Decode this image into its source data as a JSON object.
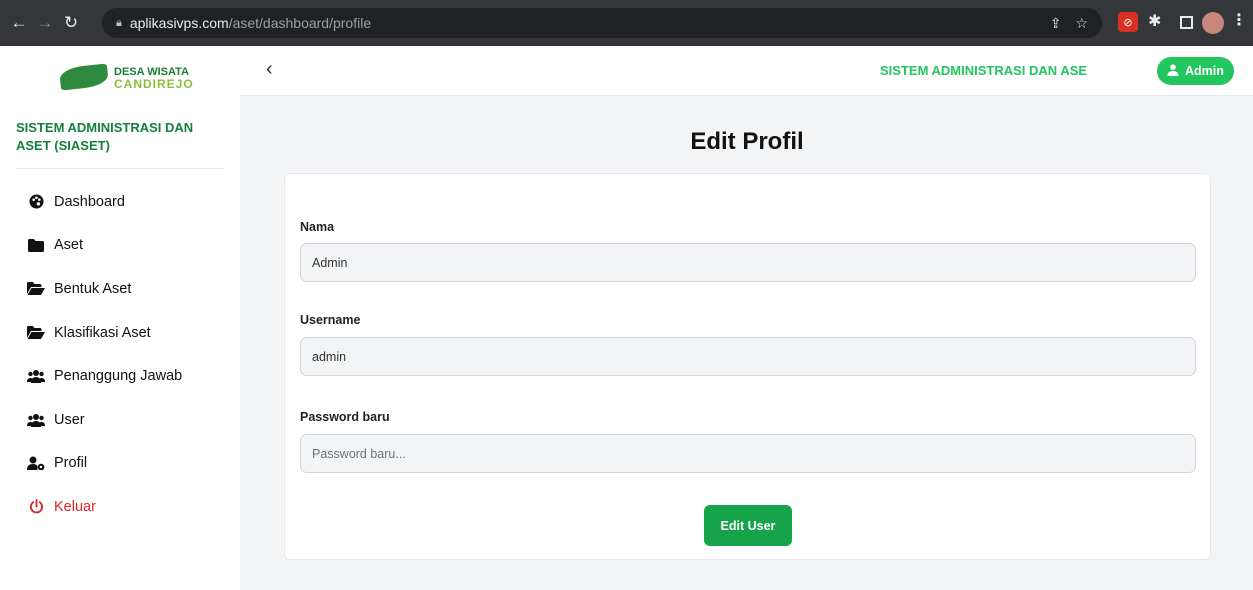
{
  "browser": {
    "url_host": "aplikasivps.com",
    "url_path": "/aset/dashboard/profile"
  },
  "sidebar": {
    "logo_line1": "DESA WISATA",
    "logo_line2": "CANDIREJO",
    "system_title": "SISTEM ADMINISTRASI DAN ASET (SIASET)",
    "items": [
      {
        "label": "Dashboard",
        "icon": "palette-icon"
      },
      {
        "label": "Aset",
        "icon": "folder-icon"
      },
      {
        "label": "Bentuk Aset",
        "icon": "folder-open-icon"
      },
      {
        "label": "Klasifikasi Aset",
        "icon": "folder-open-icon"
      },
      {
        "label": "Penanggung Jawab",
        "icon": "users-icon"
      },
      {
        "label": "User",
        "icon": "users-icon"
      },
      {
        "label": "Profil",
        "icon": "user-cog-icon"
      },
      {
        "label": "Keluar",
        "icon": "power-icon",
        "color": "#dc2626"
      }
    ]
  },
  "topbar": {
    "title": "SISTEM ADMINISTRASI DAN ASE",
    "user_label": "Admin"
  },
  "main": {
    "page_title": "Edit Profil",
    "form": {
      "name_label": "Nama",
      "name_value": "Admin",
      "username_label": "Username",
      "username_value": "admin",
      "password_label": "Password baru",
      "password_placeholder": "Password baru...",
      "submit_label": "Edit User"
    }
  },
  "colors": {
    "accent": "#22c55e",
    "button": "#16a34a",
    "sidebar_title": "#15803d",
    "logout": "#dc2626"
  }
}
